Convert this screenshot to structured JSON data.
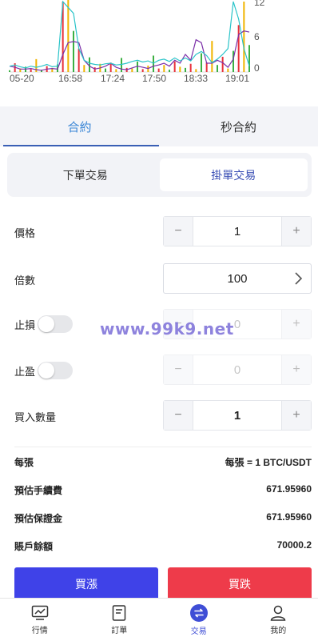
{
  "chart_data": {
    "type": "line",
    "x_ticks": [
      "05-20",
      "16:58",
      "17:24",
      "17:50",
      "18:33",
      "19:01"
    ],
    "y_ticks": [
      "12",
      "6",
      "0"
    ],
    "ylim": [
      0,
      12
    ],
    "series": [
      {
        "values": [
          1,
          0.8,
          0.5,
          0.5,
          0.6,
          0.4,
          0.3,
          0.5,
          0.6,
          0.5,
          3,
          5,
          5.2,
          5,
          2,
          1,
          0.5,
          0.7,
          1,
          1.5,
          0.8,
          0.5,
          0.4,
          0.7,
          1,
          0.8,
          0.6,
          1,
          1.2,
          1.5,
          1,
          2,
          1.5,
          3,
          2,
          5.5,
          5,
          1.5,
          1.5,
          2,
          1.6,
          0.8,
          2.2,
          6.4,
          7,
          6.8
        ]
      },
      {
        "values": [
          1,
          1.2,
          0.9,
          0.7,
          1,
          0.8,
          1,
          1.3,
          0.9,
          1,
          12,
          11,
          10,
          4,
          2,
          1.5,
          1.3,
          1.2,
          1.4,
          1.5,
          1.2,
          1.3,
          1.5,
          1.8,
          2,
          1.7,
          1.9,
          1.5,
          2,
          2.2,
          1.8,
          2.4,
          1.9,
          2.4,
          1.9,
          3,
          3.5,
          2.8,
          1.6,
          2.2,
          3,
          4,
          12,
          9,
          4,
          1
        ]
      }
    ],
    "bars": [
      0.3,
      1.5,
      0.6,
      0.9,
      0.5,
      2.2,
      0.4,
      1,
      0.7,
      1.3,
      12,
      13,
      7,
      4,
      1.2,
      2.5,
      0.8,
      1.4,
      0.6,
      1.6,
      0.5,
      2.4,
      0.7,
      0.6,
      1.8,
      0.5,
      1.1,
      2.8,
      0.6,
      1.2,
      0.4,
      1.8,
      0.9,
      0.7,
      1.4,
      0.5,
      3.2,
      1.6,
      5.3,
      1.2,
      2.6,
      0.6,
      3.6,
      8,
      12,
      4.6
    ],
    "colors": {
      "line1": "#7b2fa8",
      "line2": "#2bc4c9",
      "bar_green": "#3cb043",
      "bar_red": "#e8313b",
      "bar_yellow": "#f0b400"
    }
  },
  "tabs": {
    "contract": "合約",
    "second_contract": "秒合約"
  },
  "segments": {
    "limit_order": "下單交易",
    "pending_order": "掛單交易"
  },
  "form": {
    "price_label": "價格",
    "price_value": "1",
    "leverage_label": "倍數",
    "leverage_value": "100",
    "stop_loss_label": "止損",
    "stop_loss_value": "0",
    "take_profit_label": "止盈",
    "take_profit_value": "0",
    "quantity_label": "買入數量",
    "quantity_value": "1",
    "minus": "−",
    "plus": "+"
  },
  "watermark": "www.99k9.net",
  "info": [
    {
      "label": "每張",
      "value": "每張 = 1 BTC/USDT"
    },
    {
      "label": "預估手續費",
      "value": "671.95960"
    },
    {
      "label": "預估保證金",
      "value": "671.95960"
    },
    {
      "label": "賬戶餘額",
      "value": "70000.2"
    }
  ],
  "actions": {
    "buy": "買漲",
    "sell": "買跌"
  },
  "nav": [
    {
      "label": "行情",
      "icon": "chart-screen-icon"
    },
    {
      "label": "訂單",
      "icon": "document-icon"
    },
    {
      "label": "交易",
      "icon": "swap-icon"
    },
    {
      "label": "我的",
      "icon": "user-icon"
    }
  ]
}
